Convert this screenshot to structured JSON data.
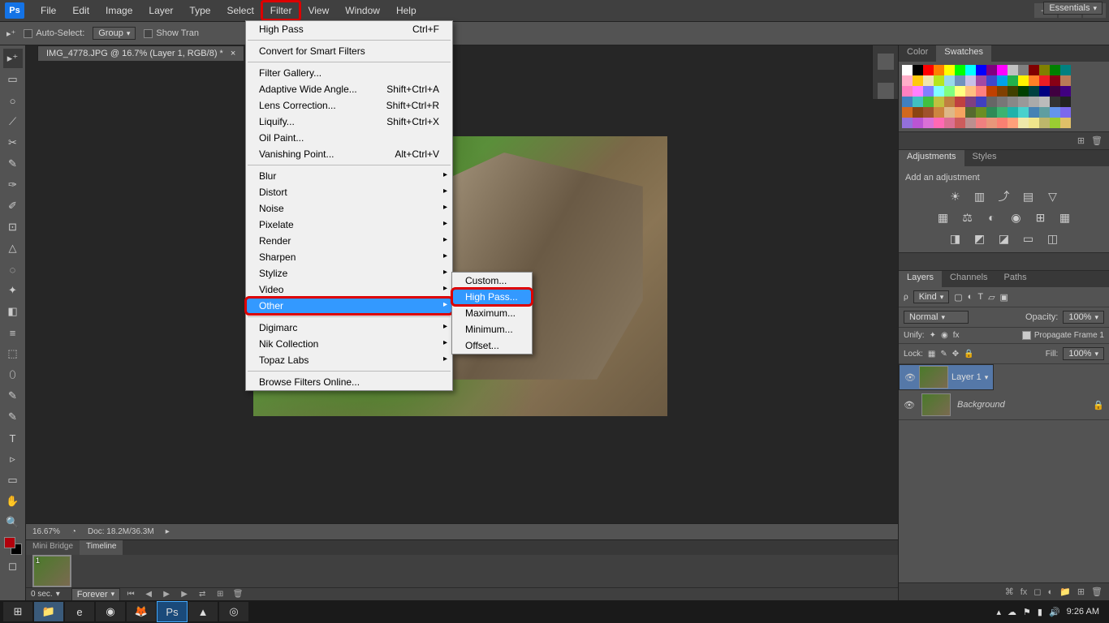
{
  "app": {
    "logo": "Ps"
  },
  "menubar": [
    "File",
    "Edit",
    "Image",
    "Layer",
    "Type",
    "Select",
    "Filter",
    "View",
    "Window",
    "Help"
  ],
  "menubar_highlight_index": 6,
  "workspace_selector": "Essentials",
  "options": {
    "auto_select": "Auto-Select:",
    "group": "Group",
    "show_trans": "Show Tran"
  },
  "doc_tab": "IMG_4778.JPG @ 16.7% (Layer 1, RGB/8) *",
  "status": {
    "zoom": "16.67%",
    "doc": "Doc: 18.2M/36.3M"
  },
  "filter_menu": {
    "top": {
      "label": "High Pass",
      "shortcut": "Ctrl+F"
    },
    "convert": "Convert for Smart Filters",
    "g1": [
      {
        "label": "Filter Gallery..."
      },
      {
        "label": "Adaptive Wide Angle...",
        "shortcut": "Shift+Ctrl+A"
      },
      {
        "label": "Lens Correction...",
        "shortcut": "Shift+Ctrl+R"
      },
      {
        "label": "Liquify...",
        "shortcut": "Shift+Ctrl+X"
      },
      {
        "label": "Oil Paint..."
      },
      {
        "label": "Vanishing Point...",
        "shortcut": "Alt+Ctrl+V"
      }
    ],
    "g2": [
      "Blur",
      "Distort",
      "Noise",
      "Pixelate",
      "Render",
      "Sharpen",
      "Stylize",
      "Video",
      "Other"
    ],
    "g3": [
      "Digimarc",
      "Nik Collection",
      "Topaz Labs"
    ],
    "browse": "Browse Filters Online..."
  },
  "submenu_other": [
    "Custom...",
    "High Pass...",
    "Maximum...",
    "Minimum...",
    "Offset..."
  ],
  "panels": {
    "color_tab": "Color",
    "swatches_tab": "Swatches",
    "adjustments_tab": "Adjustments",
    "styles_tab": "Styles",
    "add_adjustment": "Add an adjustment",
    "layers_tab": "Layers",
    "channels_tab": "Channels",
    "paths_tab": "Paths",
    "kind": "Kind",
    "blend": "Normal",
    "opacity_label": "Opacity:",
    "opacity_val": "100%",
    "unify": "Unify:",
    "propagate": "Propagate Frame 1",
    "lock": "Lock:",
    "fill_label": "Fill:",
    "fill_val": "100%",
    "layers": [
      {
        "name": "Layer 1",
        "locked": false
      },
      {
        "name": "Background",
        "locked": true
      }
    ]
  },
  "bottom": {
    "mini_bridge": "Mini Bridge",
    "timeline": "Timeline",
    "frame_label": "1",
    "frame_time": "0 sec.",
    "forever": "Forever"
  },
  "taskbar": {
    "time": "9:26 AM"
  },
  "swatch_colors": [
    "#fff",
    "#000",
    "#f00",
    "#ff8000",
    "#ff0",
    "#0f0",
    "#0ff",
    "#00f",
    "#800080",
    "#ff00ff",
    "#c0c0c0",
    "#808080",
    "#800000",
    "#808000",
    "#008000",
    "#008080",
    "#ffaec9",
    "#ffc90e",
    "#efe4b0",
    "#b5e61d",
    "#99d9ea",
    "#7092be",
    "#c8bfe7",
    "#a349a4",
    "#3f48cc",
    "#00a2e8",
    "#22b14c",
    "#fff200",
    "#ff7f27",
    "#ed1c24",
    "#880015",
    "#b97a57",
    "#ff80c0",
    "#ff80ff",
    "#8080ff",
    "#80ffff",
    "#80ff80",
    "#ffff80",
    "#ffc080",
    "#ff8080",
    "#c04000",
    "#804000",
    "#404000",
    "#004000",
    "#004040",
    "#000080",
    "#400040",
    "#400080",
    "#4080c0",
    "#40c0c0",
    "#40c040",
    "#c0c040",
    "#c08040",
    "#c04040",
    "#804080",
    "#4040c0",
    "#666",
    "#777",
    "#888",
    "#999",
    "#aaa",
    "#bbb",
    "#333",
    "#222",
    "#d2691e",
    "#8b4513",
    "#a0522d",
    "#cd853f",
    "#deb887",
    "#f4a460",
    "#556b2f",
    "#6b8e23",
    "#2e8b57",
    "#3cb371",
    "#20b2aa",
    "#48d1cc",
    "#4682b4",
    "#5f9ea0",
    "#6495ed",
    "#7b68ee",
    "#9370db",
    "#ba55d3",
    "#da70d6",
    "#ff69b4",
    "#db7093",
    "#cd5c5c",
    "#bc8f8f",
    "#f08080",
    "#e9967a",
    "#fa8072",
    "#ffa07a",
    "#eee8aa",
    "#f0e68c",
    "#bdb76b",
    "#9acd32",
    "#e0c068"
  ]
}
